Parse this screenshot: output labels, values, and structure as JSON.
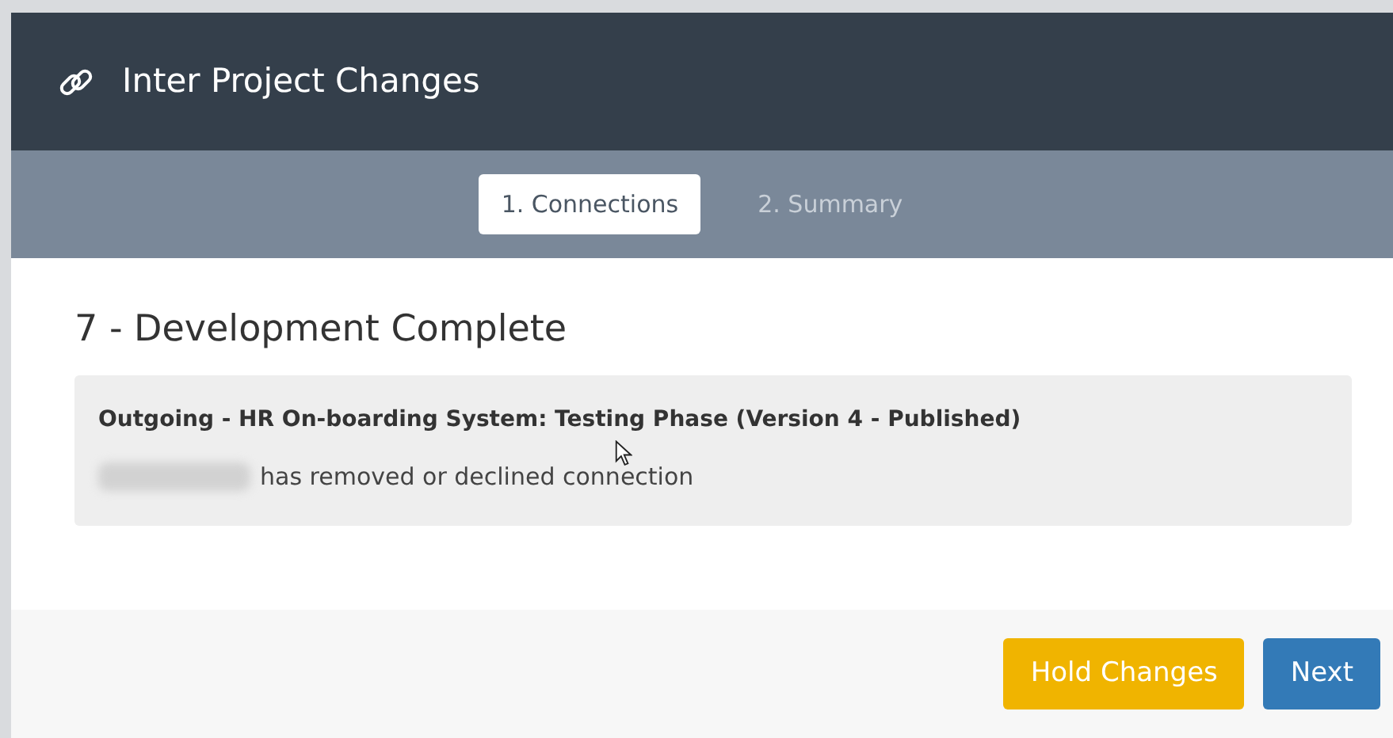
{
  "dialog": {
    "title": "Inter Project Changes"
  },
  "steps": [
    {
      "label": "1. Connections",
      "selected": true
    },
    {
      "label": "2. Summary",
      "selected": false
    }
  ],
  "section": {
    "heading": "7 - Development Complete",
    "changes": [
      {
        "title": "Outgoing - HR On-boarding System: Testing Phase (Version 4 - Published)",
        "message": "has removed or declined connection",
        "actor_redacted": true
      }
    ]
  },
  "buttons": [
    {
      "label": "Hold Changes",
      "kind": "warning"
    },
    {
      "label": "Next",
      "kind": "primary"
    }
  ]
}
